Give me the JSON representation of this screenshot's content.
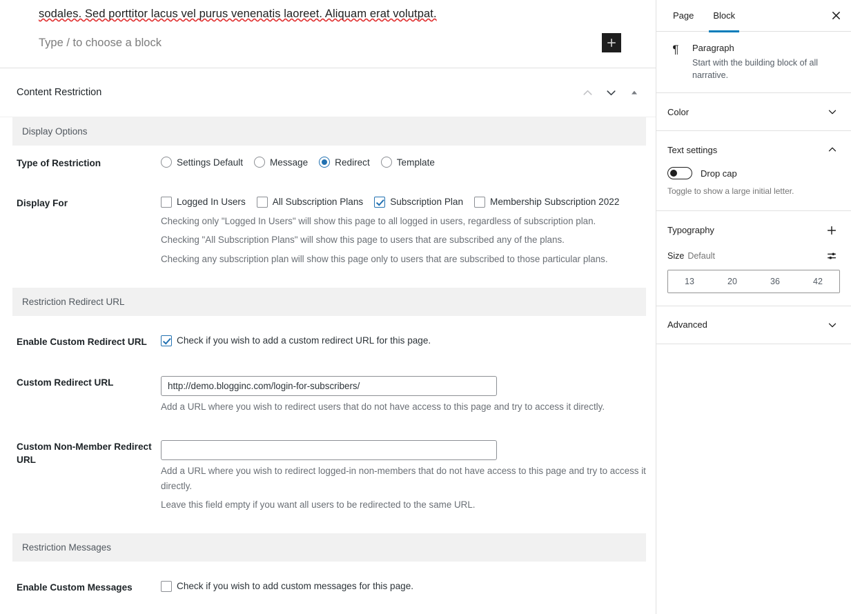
{
  "editor": {
    "paragraph_text": "sodales. Sed porttitor lacus vel purus venenatis laoreet. Aliquam erat volutpat.",
    "placeholder": "Type / to choose a block",
    "inserter_icon": "plus-icon"
  },
  "metabox": {
    "title": "Content Restriction",
    "controls": {
      "move_up_icon": "chevron-up-icon",
      "move_down_icon": "chevron-down-icon",
      "toggle_icon": "caret-up-icon"
    },
    "sections": [
      {
        "label": "Display Options"
      },
      {
        "label": "Restriction Redirect URL"
      },
      {
        "label": "Restriction Messages"
      }
    ],
    "type_of_restriction": {
      "label": "Type of Restriction",
      "options": [
        {
          "label": "Settings Default",
          "selected": false
        },
        {
          "label": "Message",
          "selected": false
        },
        {
          "label": "Redirect",
          "selected": true
        },
        {
          "label": "Template",
          "selected": false
        }
      ]
    },
    "display_for": {
      "label": "Display For",
      "options": [
        {
          "label": "Logged In Users",
          "checked": false
        },
        {
          "label": "All Subscription Plans",
          "checked": false
        },
        {
          "label": "Subscription Plan",
          "checked": true
        },
        {
          "label": "Membership Subscription 2022",
          "checked": false
        }
      ],
      "help": [
        "Checking only \"Logged In Users\" will show this page to all logged in users, regardless of subscription plan.",
        "Checking \"All Subscription Plans\" will show this page to users that are subscribed any of the plans.",
        "Checking any subscription plan will show this page only to users that are subscribed to those particular plans."
      ]
    },
    "enable_custom_redirect": {
      "label": "Enable Custom Redirect URL",
      "checkbox_label": "Check if you wish to add a custom redirect URL for this page.",
      "checked": true
    },
    "custom_redirect_url": {
      "label": "Custom Redirect URL",
      "value": "http://demo.blogginc.com/login-for-subscribers/",
      "help": "Add a URL where you wish to redirect users that do not have access to this page and try to access it directly."
    },
    "custom_non_member_redirect_url": {
      "label": "Custom Non-Member Redirect URL",
      "value": "",
      "help_1": "Add a URL where you wish to redirect logged-in non-members that do not have access to this page and try to access it directly.",
      "help_2": "Leave this field empty if you want all users to be redirected to the same URL."
    },
    "enable_custom_messages": {
      "label": "Enable Custom Messages",
      "checkbox_label": "Check if you wish to add custom messages for this page.",
      "checked": false
    }
  },
  "sidebar": {
    "tabs": [
      {
        "label": "Page",
        "active": false
      },
      {
        "label": "Block",
        "active": true
      }
    ],
    "close_icon": "close-icon",
    "block_card": {
      "icon": "paragraph-icon",
      "icon_glyph": "¶",
      "name": "Paragraph",
      "description": "Start with the building block of all narrative."
    },
    "panels": {
      "color": {
        "title": "Color",
        "state_icon": "chevron-down-icon"
      },
      "text_settings": {
        "title": "Text settings",
        "state_icon": "chevron-up-icon",
        "drop_cap_label": "Drop cap",
        "drop_cap_on": false,
        "drop_cap_help": "Toggle to show a large initial letter."
      },
      "typography": {
        "title": "Typography",
        "add_icon": "plus-icon",
        "size_label": "Size",
        "size_value": "Default",
        "sliders_icon": "sliders-icon",
        "sizes": [
          "13",
          "20",
          "36",
          "42"
        ]
      },
      "advanced": {
        "title": "Advanced",
        "state_icon": "chevron-down-icon"
      }
    }
  },
  "colors": {
    "accent": "#2271b1",
    "tab_active": "#007cba",
    "section_bar": "#f1f1f1",
    "border": "#e0e0e0"
  }
}
